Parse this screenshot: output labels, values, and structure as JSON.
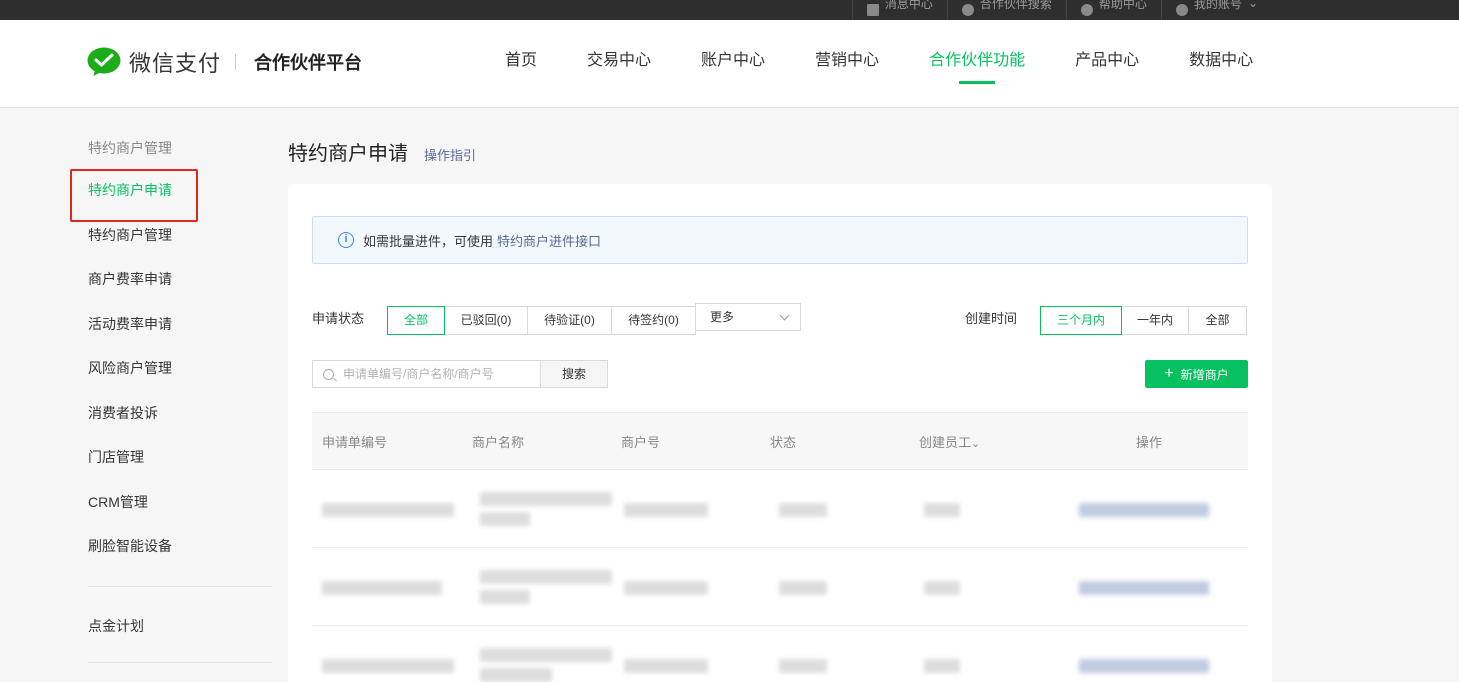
{
  "topbar": {
    "items": [
      "消息中心",
      "合作伙伴搜索",
      "帮助中心",
      "我的账号"
    ]
  },
  "header": {
    "logo_text": "微信支付",
    "platform": "合作伙伴平台",
    "nav": [
      "首页",
      "交易中心",
      "账户中心",
      "营销中心",
      "合作伙伴功能",
      "产品中心",
      "数据中心"
    ],
    "active_nav": "合作伙伴功能"
  },
  "sidebar": {
    "group_title": "特约商户管理",
    "items": [
      "特约商户申请",
      "特约商户管理",
      "商户费率申请",
      "活动费率申请",
      "风险商户管理",
      "消费者投诉",
      "门店管理",
      "CRM管理",
      "刷脸智能设备"
    ],
    "extra_item": "点金计划",
    "active_item": "特约商户申请"
  },
  "page": {
    "title": "特约商户申请",
    "guide_link": "操作指引"
  },
  "notice": {
    "text": "如需批量进件，可使用",
    "link": "特约商户进件接口"
  },
  "filters": {
    "status_label": "申请状态",
    "status_options": [
      "全部",
      "已驳回(0)",
      "待验证(0)",
      "待签约(0)"
    ],
    "status_active": "全部",
    "more_label": "更多",
    "time_label": "创建时间",
    "time_options": [
      "三个月内",
      "一年内",
      "全部"
    ],
    "time_active": "三个月内"
  },
  "search": {
    "placeholder": "申请单编号/商户名称/商户号",
    "value": "",
    "button": "搜索"
  },
  "add_button": "新增商户",
  "table": {
    "columns": [
      "申请单编号",
      "商户名称",
      "商户号",
      "状态",
      "创建员工",
      "操作"
    ]
  },
  "colors": {
    "accent": "#07c160",
    "link": "#576b95",
    "highlight_box": "#e0271e"
  }
}
